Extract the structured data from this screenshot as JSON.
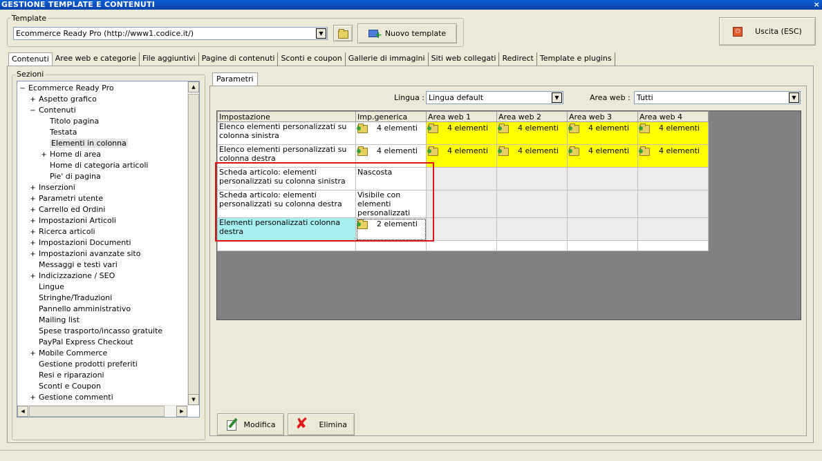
{
  "window": {
    "title": "GESTIONE TEMPLATE E CONTENUTI",
    "close": "×"
  },
  "template": {
    "legend": "Template",
    "selected": "Ecommerce Ready Pro (http://www1.codice.it/)",
    "new_button": "Nuovo template"
  },
  "exit_button": "Uscita (ESC)",
  "tabs": [
    "Contenuti",
    "Aree web e categorie",
    "File aggiuntivi",
    "Pagine di contenuti",
    "Sconti e coupon",
    "Gallerie di immagini",
    "Siti web collegati",
    "Redirect",
    "Template e plugins"
  ],
  "sections": {
    "legend": "Sezioni",
    "tree": [
      {
        "label": "Ecommerce Ready Pro",
        "level": 0,
        "exp": "−"
      },
      {
        "label": "Aspetto grafico",
        "level": 1,
        "exp": "+"
      },
      {
        "label": "Contenuti",
        "level": 1,
        "exp": "−"
      },
      {
        "label": "Titolo pagina",
        "level": 2,
        "exp": ""
      },
      {
        "label": "Testata",
        "level": 2,
        "exp": ""
      },
      {
        "label": "Elementi in colonna",
        "level": 2,
        "exp": "",
        "selected": true
      },
      {
        "label": "Home di area",
        "level": 2,
        "exp": "+"
      },
      {
        "label": "Home di categoria articoli",
        "level": 2,
        "exp": ""
      },
      {
        "label": "Pie' di pagina",
        "level": 2,
        "exp": ""
      },
      {
        "label": "Inserzioni",
        "level": 1,
        "exp": "+"
      },
      {
        "label": "Parametri utente",
        "level": 1,
        "exp": "+"
      },
      {
        "label": "Carrello ed Ordini",
        "level": 1,
        "exp": "+"
      },
      {
        "label": "Impostazioni Articoli",
        "level": 1,
        "exp": "+"
      },
      {
        "label": "Ricerca articoli",
        "level": 1,
        "exp": "+"
      },
      {
        "label": "Impostazioni Documenti",
        "level": 1,
        "exp": "+"
      },
      {
        "label": "Impostazioni avanzate sito",
        "level": 1,
        "exp": "+"
      },
      {
        "label": "Messaggi e testi vari",
        "level": 1,
        "exp": ""
      },
      {
        "label": "Indicizzazione / SEO",
        "level": 1,
        "exp": "+"
      },
      {
        "label": "Lingue",
        "level": 1,
        "exp": ""
      },
      {
        "label": "Stringhe/Traduzioni",
        "level": 1,
        "exp": ""
      },
      {
        "label": "Pannello amministrativo",
        "level": 1,
        "exp": ""
      },
      {
        "label": "Mailing list",
        "level": 1,
        "exp": ""
      },
      {
        "label": "Spese trasporto/incasso gratuite",
        "level": 1,
        "exp": ""
      },
      {
        "label": "PayPal Express Checkout",
        "level": 1,
        "exp": ""
      },
      {
        "label": "Mobile Commerce",
        "level": 1,
        "exp": "+"
      },
      {
        "label": "Gestione prodotti preferiti",
        "level": 1,
        "exp": ""
      },
      {
        "label": "Resi e riparazioni",
        "level": 1,
        "exp": ""
      },
      {
        "label": "Sconti e Coupon",
        "level": 1,
        "exp": ""
      },
      {
        "label": "Gestione commenti",
        "level": 1,
        "exp": "+"
      }
    ]
  },
  "params": {
    "tab": "Parametri",
    "lingua_label": "Lingua :",
    "lingua_value": "Lingua default",
    "area_label": "Area web :",
    "area_value": "Tutti"
  },
  "grid": {
    "columns": [
      "Impostazione",
      "Imp.generica",
      "Area web 1",
      "Area web 2",
      "Area web 3",
      "Area web 4"
    ],
    "rows": [
      {
        "setting": "Elenco elementi personalizzati su colonna sinistra",
        "generic": "4 elementi",
        "generic_icon": true,
        "areas": [
          "4 elementi",
          "4 elementi",
          "4 elementi",
          "4 elementi"
        ]
      },
      {
        "setting": "Elenco elementi personalizzati su colonna destra",
        "generic": "4 elementi",
        "generic_icon": true,
        "areas": [
          "4 elementi",
          "4 elementi",
          "4 elementi",
          "4 elementi"
        ]
      },
      {
        "setting": "Scheda articolo: elementi personalizzati su colonna sinistra",
        "generic": "Nascosta",
        "generic_icon": false,
        "areas": []
      },
      {
        "setting": "Scheda articolo: elementi personalizzati su colonna destra",
        "generic": "Visibile con elementi personalizzati",
        "generic_icon": false,
        "areas": []
      },
      {
        "setting": "Elementi personalizzati colonna destra",
        "generic": "2 elementi",
        "generic_icon": true,
        "areas": [],
        "selected": true
      }
    ]
  },
  "actions": {
    "modify": "Modifica",
    "delete": "Elimina"
  },
  "colors": {
    "area_fill": "#ffff00",
    "selected_row": "#a7f0f0",
    "highlight_box": "#e01010",
    "titlebar": "#0a5fd6"
  }
}
